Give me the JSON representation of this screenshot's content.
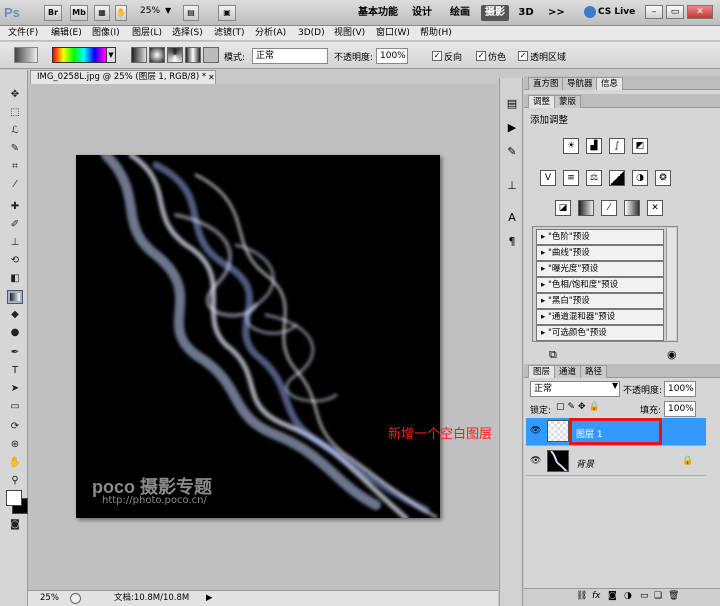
{
  "app": {
    "logo": "Ps",
    "bridge": "Br",
    "minibridge": "Mb",
    "zoom": "25%"
  },
  "workspaces": [
    "基本功能",
    "设计",
    "绘画",
    "摄影",
    "3D",
    ">>"
  ],
  "active_workspace": "摄影",
  "cs_live": "CS Live",
  "menus": [
    "文件(F)",
    "编辑(E)",
    "图像(I)",
    "图层(L)",
    "选择(S)",
    "滤镜(T)",
    "分析(A)",
    "3D(D)",
    "视图(V)",
    "窗口(W)",
    "帮助(H)"
  ],
  "options": {
    "mode_label": "模式:",
    "mode_value": "正常",
    "opacity_label": "不透明度:",
    "opacity_value": "100%",
    "reverse": "反向",
    "dither": "仿色",
    "transparency": "透明区域"
  },
  "document": {
    "tab": "IMG_0258L.jpg @ 25% (图层 1, RGB/8) *",
    "watermark_logo": "poco 摄影专题",
    "watermark_url": "http://photo.poco.cn/",
    "status_zoom": "25%",
    "status_doc": "文档:10.8M/10.8M"
  },
  "panel_tabs_top": [
    "直方图",
    "导航器",
    "信息"
  ],
  "adjust_tabs": [
    "调整",
    "蒙版"
  ],
  "adjust_title": "添加调整",
  "presets": [
    "\"色阶\"预设",
    "\"曲线\"预设",
    "\"曝光度\"预设",
    "\"色相/饱和度\"预设",
    "\"黑白\"预设",
    "\"通道混和器\"预设",
    "\"可选颜色\"预设"
  ],
  "layers_tabs": [
    "图层",
    "通道",
    "路径"
  ],
  "layers": {
    "blend": "正常",
    "opacity_label": "不透明度:",
    "opacity": "100%",
    "lock_label": "锁定:",
    "fill_label": "填充:",
    "fill": "100%",
    "items": [
      {
        "name": "图层 1",
        "selected": true
      },
      {
        "name": "背景",
        "selected": false
      }
    ]
  },
  "annotation": "新增一个空白图层",
  "colors": {
    "accent": "#3399ff",
    "annotation": "#ff1a1a"
  }
}
